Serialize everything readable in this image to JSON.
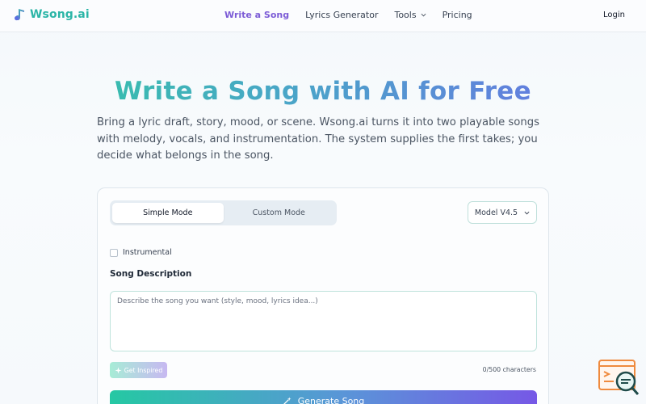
{
  "header": {
    "brand": "Wsong.ai",
    "nav": [
      {
        "label": "Write a Song",
        "active": true
      },
      {
        "label": "Lyrics Generator",
        "active": false
      },
      {
        "label": "Tools",
        "active": false,
        "has_dropdown": true
      },
      {
        "label": "Pricing",
        "active": false
      }
    ],
    "login": "Login"
  },
  "hero": {
    "title": "Write a Song with AI for Free",
    "description": "Bring a lyric draft, story, mood, or scene. Wsong.ai turns it into two playable songs with melody, vocals, and instrumentation. The system supplies the first takes; you decide what belongs in the song."
  },
  "form": {
    "modes": [
      {
        "label": "Simple Mode",
        "active": true
      },
      {
        "label": "Custom Mode",
        "active": false
      }
    ],
    "model_select": "Model V4.5",
    "instrumental_label": "Instrumental",
    "instrumental_checked": false,
    "description_label": "Song Description",
    "description_placeholder": "Describe the song you want (style, mood, lyrics idea...)",
    "description_value": "",
    "inspire_label": "Get Inspired",
    "char_count": "0/500 characters",
    "generate_label": "Generate Song"
  },
  "icons": {
    "brand": "music-note-icon",
    "tools_dropdown": "chevron-down-icon",
    "model_dropdown": "chevron-down-icon",
    "inspire": "sparkle-icon",
    "generate": "magic-wand-icon",
    "floating": "search-chat-icon"
  },
  "colors": {
    "brand": "#2bb5a7",
    "nav_active": "#7c5cd6",
    "gradient_start": "#25c8a3",
    "gradient_end": "#7658e6",
    "widget_accent": "#ef8a3e"
  }
}
